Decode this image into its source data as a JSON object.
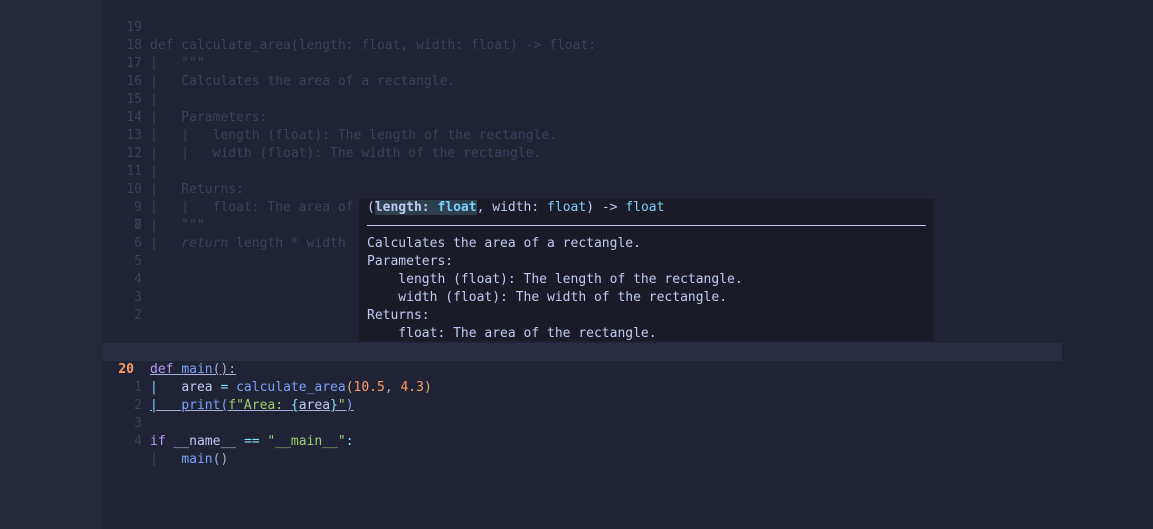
{
  "editor": {
    "lines": [
      {
        "num": "19",
        "text": "def calculate_area(length: float, width: float) -> float:"
      },
      {
        "num": "18",
        "guide": "|",
        "text": "   \"\"\""
      },
      {
        "num": "17",
        "guide": "|",
        "text": "   Calculates the area of a rectangle."
      },
      {
        "num": "16",
        "guide": "|",
        "text": ""
      },
      {
        "num": "15",
        "guide": "|",
        "text": "   Parameters:"
      },
      {
        "num": "14",
        "guide": "|",
        "text": "   |   length (float): The length of the rectangle."
      },
      {
        "num": "13",
        "guide": "|",
        "text": "   |   width (float): The width of the rectangle."
      },
      {
        "num": "12",
        "guide": "|",
        "text": ""
      },
      {
        "num": "11",
        "guide": "|",
        "text": "   Returns:"
      },
      {
        "num": "10",
        "guide": "|",
        "text": "   |   float: The area of the rectangle."
      },
      {
        "num": "9",
        "guide": "|",
        "text": "   \"\"\""
      },
      {
        "num": "8",
        "guide": "|",
        "kw": "return",
        "text": " length * width"
      },
      {
        "num": "7"
      },
      {
        "num": "6"
      },
      {
        "num": "5"
      },
      {
        "num": "4"
      },
      {
        "num": "3"
      },
      {
        "num": "2"
      }
    ],
    "main_def": {
      "num": "1",
      "kw": "def",
      "name": "main",
      "rest": "():"
    },
    "current": {
      "num": "20",
      "guide": "|",
      "var": "area",
      "eq": "=",
      "fn": "calculate_area",
      "open": "(",
      "arg1": "10.5",
      "comma": ",",
      "arg2": "4.3",
      "close": ")"
    },
    "print_line": {
      "num": "1",
      "guide": "|",
      "fn": "print",
      "open": "(",
      "fstr_pre": "f\"Area: ",
      "brace_open": "{",
      "inner": "area",
      "brace_close": "}",
      "fstr_post": "\"",
      "close": ")"
    },
    "blank": {
      "num": "2"
    },
    "if_line": {
      "num": "3",
      "kw": "if",
      "dunder": "__name__",
      "op": "==",
      "str": "\"__main__\"",
      "colon": ":"
    },
    "call_line": {
      "num": "4",
      "guide": "|",
      "fn": "main",
      "paren": "()"
    }
  },
  "signature_help": {
    "open": "(",
    "p1_name": "length:",
    "p1_type": "float",
    "sep1": ", ",
    "p2_name": "width:",
    "p2_type": "float",
    "close_arrow": ") -> ",
    "ret_type": "float",
    "doc": [
      "Calculates the area of a rectangle.",
      "Parameters:",
      "    length (float): The length of the rectangle.",
      "    width (float): The width of the rectangle.",
      "Returns:",
      "    float: The area of the rectangle."
    ]
  },
  "colors": {
    "background": "#24283b",
    "editor_bg": "#1f2335",
    "popup_bg": "#1a1b26",
    "current_line": "#292e42",
    "keyword": "#bb9af7",
    "function": "#7aa2f7",
    "number": "#ff9e64",
    "string": "#9ece6a",
    "type": "#7dcfff"
  }
}
